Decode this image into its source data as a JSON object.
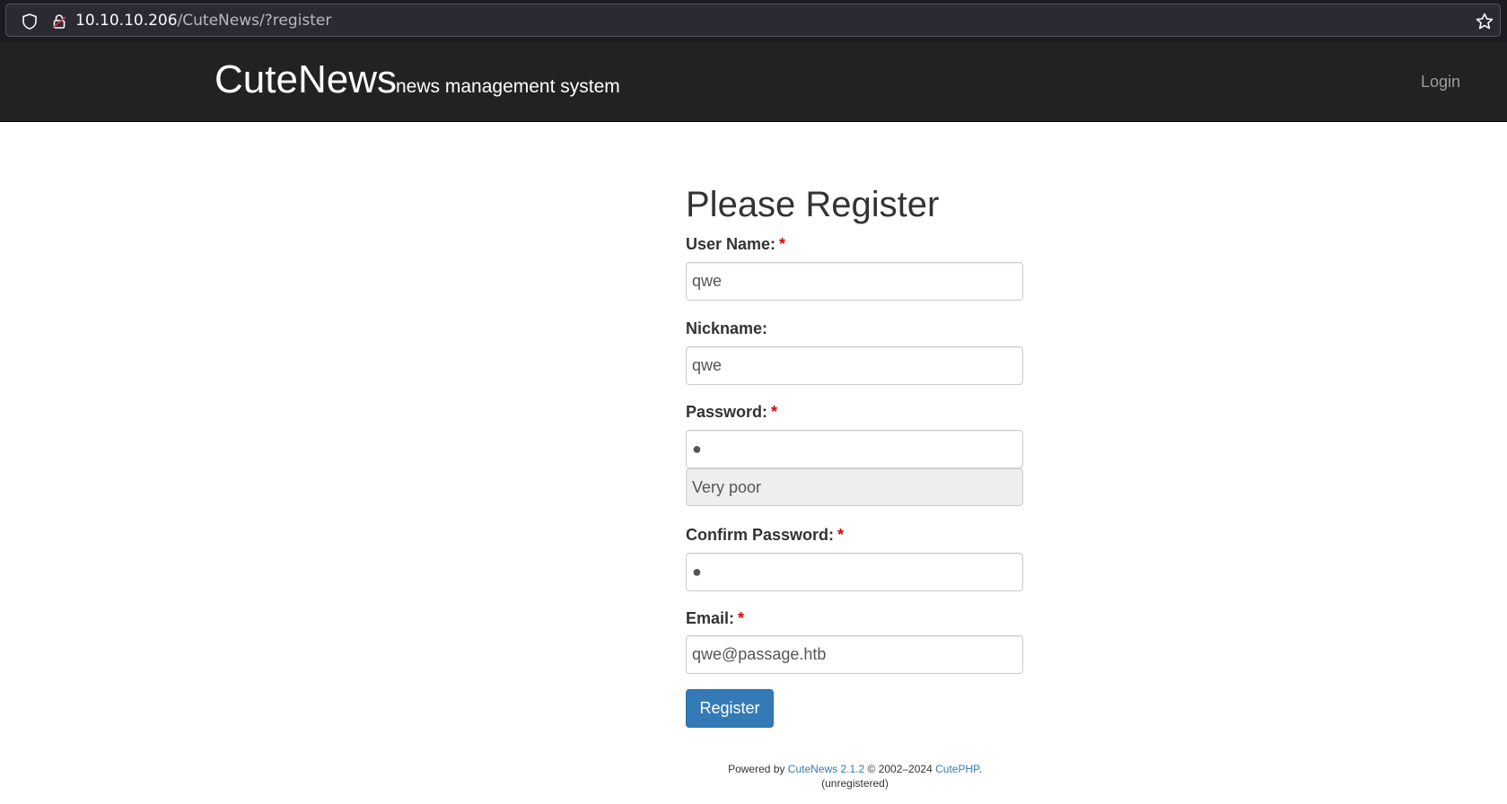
{
  "browser": {
    "url_host": "10.10.10.206",
    "url_path": "/CuteNews/?register"
  },
  "navbar": {
    "brand": "CuteNews",
    "subtitle": "news management system",
    "login_label": "Login"
  },
  "form": {
    "title": "Please Register",
    "username_label": "User Name:",
    "username_value": "qwe",
    "nickname_label": "Nickname:",
    "nickname_value": "qwe",
    "password_label": "Password:",
    "password_value": "●",
    "password_strength": "Very poor",
    "confirm_label": "Confirm Password:",
    "confirm_value": "●",
    "email_label": "Email:",
    "email_value": "qwe@passage.htb",
    "required_mark": "*",
    "submit_label": "Register"
  },
  "footer": {
    "powered_by": "Powered by",
    "product_link": "CuteNews 2.1.2",
    "copyright": "© 2002–2024",
    "vendor_link": "CutePHP",
    "period": ".",
    "status": "(unregistered)"
  }
}
